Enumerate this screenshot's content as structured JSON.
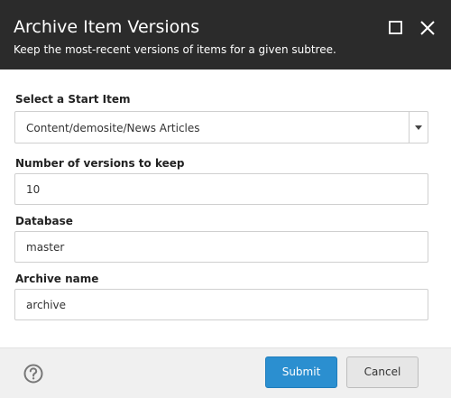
{
  "dialog": {
    "title": "Archive Item Versions",
    "subtitle": "Keep the most-recent versions of items for a given subtree."
  },
  "header_icons": {
    "maximize": "maximize-icon",
    "close": "close-icon"
  },
  "form": {
    "start_item": {
      "label": "Select a Start Item",
      "value": "Content/demosite/News Articles"
    },
    "versions": {
      "label": "Number of versions to keep",
      "value": "10"
    },
    "database": {
      "label": "Database",
      "value": "master"
    },
    "archive": {
      "label": "Archive name",
      "value": "archive"
    }
  },
  "footer": {
    "help_icon": "help-icon",
    "submit_label": "Submit",
    "cancel_label": "Cancel"
  },
  "colors": {
    "header_bg": "#2b2b2b",
    "submit_bg": "#2b8fd0",
    "footer_bg": "#f0f0f0"
  }
}
